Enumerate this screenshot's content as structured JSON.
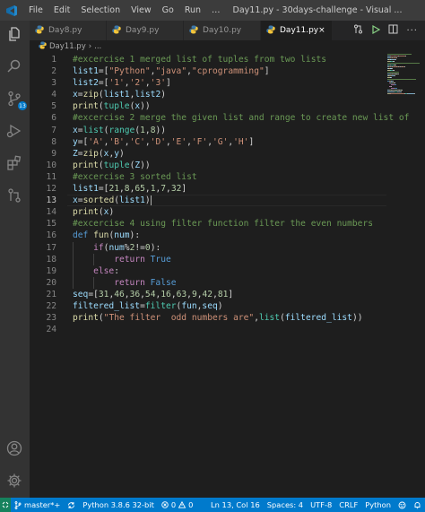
{
  "window": {
    "menu": [
      "File",
      "Edit",
      "Selection",
      "View",
      "Go",
      "Run",
      "…"
    ],
    "title": "Day11.py - 30days-challenge - Visual ..."
  },
  "tabs": [
    {
      "label": "Day8.py",
      "active": false
    },
    {
      "label": "Day9.py",
      "active": false
    },
    {
      "label": "Day10.py",
      "active": false
    },
    {
      "label": "Day11.py",
      "active": true,
      "close": "×"
    }
  ],
  "breadcrumb": {
    "file": "Day11.py",
    "sep": "›",
    "rest": "..."
  },
  "activity": {
    "scm_badge": "13"
  },
  "editor": {
    "current_line": 13,
    "lines": [
      [
        [
          "c-com",
          "#excercise 1 merged list of tuples from two lists"
        ]
      ],
      [
        [
          "c-var",
          "list1"
        ],
        [
          "c-op",
          "=["
        ],
        [
          "c-str",
          "\"Python\""
        ],
        [
          "c-op",
          ","
        ],
        [
          "c-str",
          "\"java\""
        ],
        [
          "c-op",
          ","
        ],
        [
          "c-str",
          "\"cprogramming\""
        ],
        [
          "c-op",
          "]"
        ]
      ],
      [
        [
          "c-var",
          "list2"
        ],
        [
          "c-op",
          "=["
        ],
        [
          "c-str",
          "'1'"
        ],
        [
          "c-op",
          ","
        ],
        [
          "c-str",
          "'2'"
        ],
        [
          "c-op",
          ","
        ],
        [
          "c-str",
          "'3'"
        ],
        [
          "c-op",
          "]"
        ]
      ],
      [
        [
          "c-var",
          "x"
        ],
        [
          "c-op",
          "="
        ],
        [
          "c-fn",
          "zip"
        ],
        [
          "c-op",
          "("
        ],
        [
          "c-var",
          "list1"
        ],
        [
          "c-op",
          ","
        ],
        [
          "c-var",
          "list2"
        ],
        [
          "c-op",
          ")"
        ]
      ],
      [
        [
          "c-fn",
          "print"
        ],
        [
          "c-op",
          "("
        ],
        [
          "c-cls",
          "tuple"
        ],
        [
          "c-op",
          "("
        ],
        [
          "c-var",
          "x"
        ],
        [
          "c-op",
          "))"
        ]
      ],
      [
        [
          "c-com",
          "#excercise 2 merge the given list and range to create new list of"
        ]
      ],
      [
        [
          "c-var",
          "x"
        ],
        [
          "c-op",
          "="
        ],
        [
          "c-cls",
          "list"
        ],
        [
          "c-op",
          "("
        ],
        [
          "c-cls",
          "range"
        ],
        [
          "c-op",
          "("
        ],
        [
          "c-num",
          "1"
        ],
        [
          "c-op",
          ","
        ],
        [
          "c-num",
          "8"
        ],
        [
          "c-op",
          "))"
        ]
      ],
      [
        [
          "c-var",
          "y"
        ],
        [
          "c-op",
          "=["
        ],
        [
          "c-str",
          "'A'"
        ],
        [
          "c-op",
          ","
        ],
        [
          "c-str",
          "'B'"
        ],
        [
          "c-op",
          ","
        ],
        [
          "c-str",
          "'C'"
        ],
        [
          "c-op",
          ","
        ],
        [
          "c-str",
          "'D'"
        ],
        [
          "c-op",
          ","
        ],
        [
          "c-str",
          "'E'"
        ],
        [
          "c-op",
          ","
        ],
        [
          "c-str",
          "'F'"
        ],
        [
          "c-op",
          ","
        ],
        [
          "c-str",
          "'G'"
        ],
        [
          "c-op",
          ","
        ],
        [
          "c-str",
          "'H'"
        ],
        [
          "c-op",
          "]"
        ]
      ],
      [
        [
          "c-var",
          "Z"
        ],
        [
          "c-op",
          "="
        ],
        [
          "c-fn",
          "zip"
        ],
        [
          "c-op",
          "("
        ],
        [
          "c-var",
          "x"
        ],
        [
          "c-op",
          ","
        ],
        [
          "c-var",
          "y"
        ],
        [
          "c-op",
          ")"
        ]
      ],
      [
        [
          "c-fn",
          "print"
        ],
        [
          "c-op",
          "("
        ],
        [
          "c-cls",
          "tuple"
        ],
        [
          "c-op",
          "("
        ],
        [
          "c-var",
          "Z"
        ],
        [
          "c-op",
          "))"
        ]
      ],
      [
        [
          "c-com",
          "#excercise 3 sorted list"
        ]
      ],
      [
        [
          "c-var",
          "list1"
        ],
        [
          "c-op",
          "=["
        ],
        [
          "c-num",
          "21"
        ],
        [
          "c-op",
          ","
        ],
        [
          "c-num",
          "8"
        ],
        [
          "c-op",
          ","
        ],
        [
          "c-num",
          "65"
        ],
        [
          "c-op",
          ","
        ],
        [
          "c-num",
          "1"
        ],
        [
          "c-op",
          ","
        ],
        [
          "c-num",
          "7"
        ],
        [
          "c-op",
          ","
        ],
        [
          "c-num",
          "32"
        ],
        [
          "c-op",
          "]"
        ]
      ],
      [
        [
          "c-var",
          "x"
        ],
        [
          "c-op",
          "="
        ],
        [
          "c-fn",
          "sorted"
        ],
        [
          "c-op",
          "("
        ],
        [
          "c-var",
          "list1"
        ],
        [
          "c-op",
          ")"
        ]
      ],
      [
        [
          "c-fn",
          "print"
        ],
        [
          "c-op",
          "("
        ],
        [
          "c-var",
          "x"
        ],
        [
          "c-op",
          ")"
        ]
      ],
      [
        [
          "c-com",
          "#excercise 4 using filter function filter the even numbers"
        ]
      ],
      [
        [
          "c-def",
          "def "
        ],
        [
          "c-fn",
          "fun"
        ],
        [
          "c-op",
          "("
        ],
        [
          "c-var",
          "num"
        ],
        [
          "c-op",
          "):"
        ]
      ],
      [
        [
          "c-op",
          "    "
        ],
        [
          "c-kw",
          "if"
        ],
        [
          "c-op",
          "("
        ],
        [
          "c-var",
          "num"
        ],
        [
          "c-op",
          "%"
        ],
        [
          "c-num",
          "2"
        ],
        [
          "c-op",
          "!="
        ],
        [
          "c-num",
          "0"
        ],
        [
          "c-op",
          "):"
        ]
      ],
      [
        [
          "c-op",
          "        "
        ],
        [
          "c-kw",
          "return "
        ],
        [
          "c-def",
          "True"
        ]
      ],
      [
        [
          "c-op",
          "    "
        ],
        [
          "c-kw",
          "else"
        ],
        [
          "c-op",
          ":"
        ]
      ],
      [
        [
          "c-op",
          "        "
        ],
        [
          "c-kw",
          "return "
        ],
        [
          "c-def",
          "False"
        ]
      ],
      [
        [
          "c-var",
          "seq"
        ],
        [
          "c-op",
          "=["
        ],
        [
          "c-num",
          "31"
        ],
        [
          "c-op",
          ","
        ],
        [
          "c-num",
          "46"
        ],
        [
          "c-op",
          ","
        ],
        [
          "c-num",
          "36"
        ],
        [
          "c-op",
          ","
        ],
        [
          "c-num",
          "54"
        ],
        [
          "c-op",
          ","
        ],
        [
          "c-num",
          "16"
        ],
        [
          "c-op",
          ","
        ],
        [
          "c-num",
          "63"
        ],
        [
          "c-op",
          ","
        ],
        [
          "c-num",
          "9"
        ],
        [
          "c-op",
          ","
        ],
        [
          "c-num",
          "42"
        ],
        [
          "c-op",
          ","
        ],
        [
          "c-num",
          "81"
        ],
        [
          "c-op",
          "]"
        ]
      ],
      [
        [
          "c-var",
          "filtered_list"
        ],
        [
          "c-op",
          "="
        ],
        [
          "c-cls",
          "filter"
        ],
        [
          "c-op",
          "("
        ],
        [
          "c-var",
          "fun"
        ],
        [
          "c-op",
          ","
        ],
        [
          "c-var",
          "seq"
        ],
        [
          "c-op",
          ")"
        ]
      ],
      [
        [
          "c-fn",
          "print"
        ],
        [
          "c-op",
          "("
        ],
        [
          "c-str",
          "\"The filter  odd numbers are\""
        ],
        [
          "c-op",
          ","
        ],
        [
          "c-cls",
          "list"
        ],
        [
          "c-op",
          "("
        ],
        [
          "c-var",
          "filtered_list"
        ],
        [
          "c-op",
          "))"
        ]
      ],
      []
    ]
  },
  "status": {
    "branch": "master*+",
    "interpreter": "Python 3.8.6 32-bit",
    "errors": "0",
    "warnings": "0",
    "position": "Ln 13, Col 16",
    "spaces": "Spaces: 4",
    "encoding": "UTF-8",
    "eol": "CRLF",
    "language": "Python"
  },
  "colors": {
    "statusbar": "#007acc",
    "editor_bg": "#1e1e1e",
    "activity_bg": "#333333"
  }
}
